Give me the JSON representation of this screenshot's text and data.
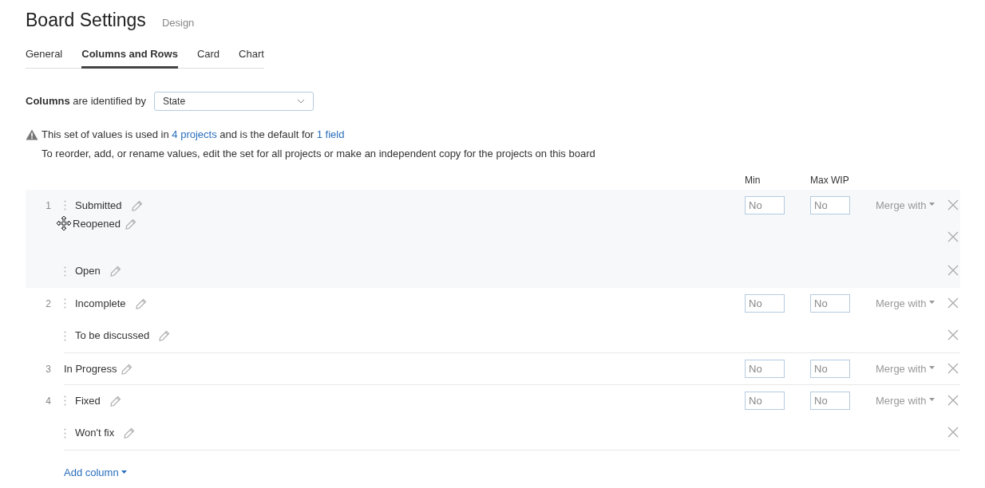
{
  "page": {
    "title": "Board Settings",
    "subtitle": "Design"
  },
  "tabs": [
    {
      "label": "General",
      "selected": false
    },
    {
      "label": "Columns and Rows",
      "selected": true
    },
    {
      "label": "Card",
      "selected": false
    },
    {
      "label": "Chart",
      "selected": false
    }
  ],
  "identified_by": {
    "label": "**Columns** are identified by",
    "value": "State"
  },
  "notice": {
    "text_before": "This set of values is used in",
    "projects_link": "4 projects",
    "text_middle": "and is the default for",
    "field_link": "1 field",
    "hint": "To reorder, add, or rename values, edit the set for all projects or make an independent copy for the projects on this board"
  },
  "table": {
    "min_header": "Min",
    "max_header": "Max WIP",
    "columns": [
      {
        "number": "1",
        "highlighted": true,
        "min": "No",
        "max_wip": "No",
        "merge": "Merge with",
        "values": [
          {
            "label": "Submitted",
            "handle": true,
            "dragging": false
          },
          {
            "label": "Reopened",
            "handle": false,
            "dragging": true
          },
          {
            "label": "Open",
            "handle": true,
            "dragging": false
          }
        ]
      },
      {
        "number": "2",
        "highlighted": false,
        "min": "No",
        "max_wip": "No",
        "merge": "Merge with",
        "values": [
          {
            "label": "Incomplete",
            "handle": true,
            "dragging": false
          },
          {
            "label": "To be discussed",
            "handle": true,
            "dragging": false
          }
        ]
      },
      {
        "number": "3",
        "highlighted": false,
        "min": "No",
        "max_wip": "No",
        "merge": "Merge with",
        "values": [
          {
            "label": "In Progress",
            "handle": false,
            "dragging": false
          }
        ]
      },
      {
        "number": "4",
        "highlighted": false,
        "min": "No",
        "max_wip": "No",
        "merge": "Merge with",
        "values": [
          {
            "label": "Fixed",
            "handle": true,
            "dragging": false
          },
          {
            "label": "Won't fix",
            "handle": true,
            "dragging": false
          }
        ]
      }
    ]
  },
  "add_column": "Add column"
}
